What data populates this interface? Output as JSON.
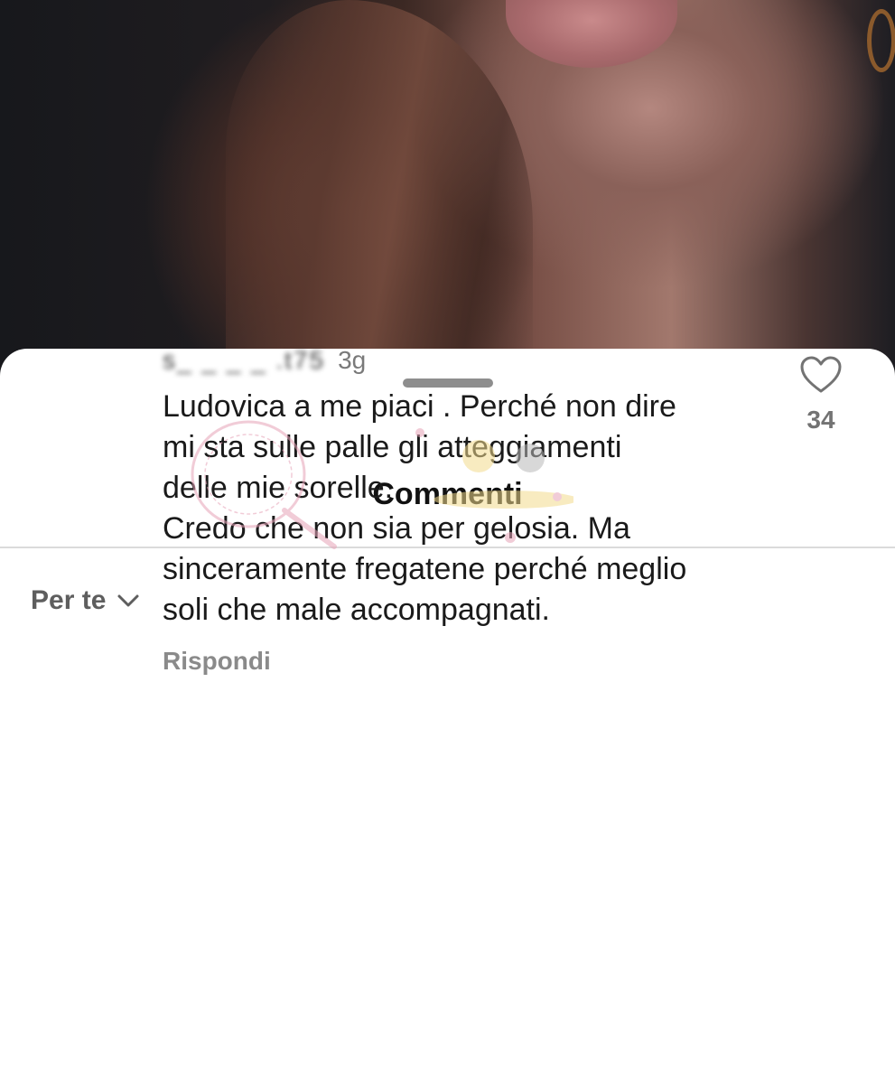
{
  "sheet": {
    "title": "Commenti"
  },
  "sort": {
    "label": "Per te",
    "icon": "chevron-down-icon"
  },
  "comment": {
    "username": "s_ _ _ _ .t75",
    "age": "3g",
    "text": "Ludovica a me piaci . Perché non dire\nmi sta sulle palle gli atteggiamenti\ndelle mie sorelle.\nCredo che non sia per gelosia. Ma\nsinceramente fregatene perché meglio\nsoli che male accompagnati.",
    "reply_label": "Rispondi",
    "likes": "34",
    "like_icon": "heart-outline-icon"
  },
  "colors": {
    "sheet_bg": "#ffffff",
    "text_primary": "#1a1a1a",
    "text_secondary": "#8a8a8a",
    "divider": "#dbdbdb"
  }
}
